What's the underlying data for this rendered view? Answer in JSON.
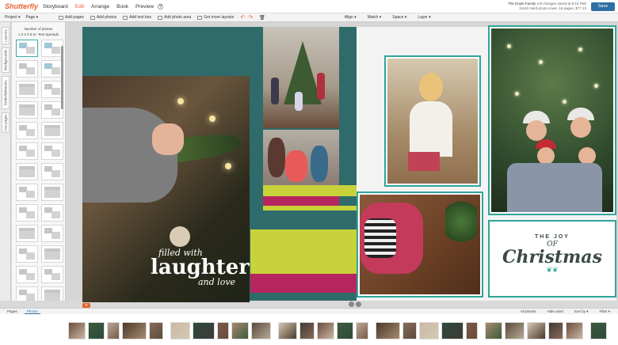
{
  "app": {
    "logo": "Shutterfly",
    "nav": [
      "Storyboard",
      "Edit",
      "Arrange",
      "Book",
      "Preview"
    ],
    "active_nav": "Edit",
    "help": "?",
    "project_title": "The Doyle Family",
    "project_status": "(All changes saved at 8:16 PM)",
    "project_meta": "10x10 Hard photo cover, 16 pages, $77.13",
    "save_label": "Save"
  },
  "toolbar": {
    "left": [
      "Project ▾",
      "Page ▾"
    ],
    "tools": [
      "Add pages",
      "Add photos",
      "Add text box",
      "Add photo area",
      "Get more layouts"
    ],
    "right": [
      "Align ▾",
      "Match ▾",
      "Space ▾",
      "Layer ▾"
    ]
  },
  "left_panel": {
    "tabs": [
      "Layouts",
      "Backgrounds",
      "Embellishments",
      "Use pages"
    ],
    "heading": "Number of photos",
    "numbers": "1  2  3  4  5  6+  Text  Spreads"
  },
  "page": {
    "laughter_line1": "filled with",
    "laughter_line2": "laughter",
    "laughter_line3": "and love",
    "joy_line1": "THE JOY",
    "joy_line2": "OF",
    "joy_line3": "Christmas",
    "holly": "❦❦"
  },
  "colors": {
    "accent": "#e8612c",
    "teal_bg": "#2f6b6a",
    "frame": "#2fa59a",
    "stripe_green": "#c8d23a",
    "stripe_magenta": "#b5255e"
  },
  "tray": {
    "tabs": [
      "Pages",
      "Photos"
    ],
    "active_tab": "Photos",
    "right": [
      "All photos",
      "Hide used",
      "Sort by ▾",
      "Filter ▾"
    ]
  }
}
